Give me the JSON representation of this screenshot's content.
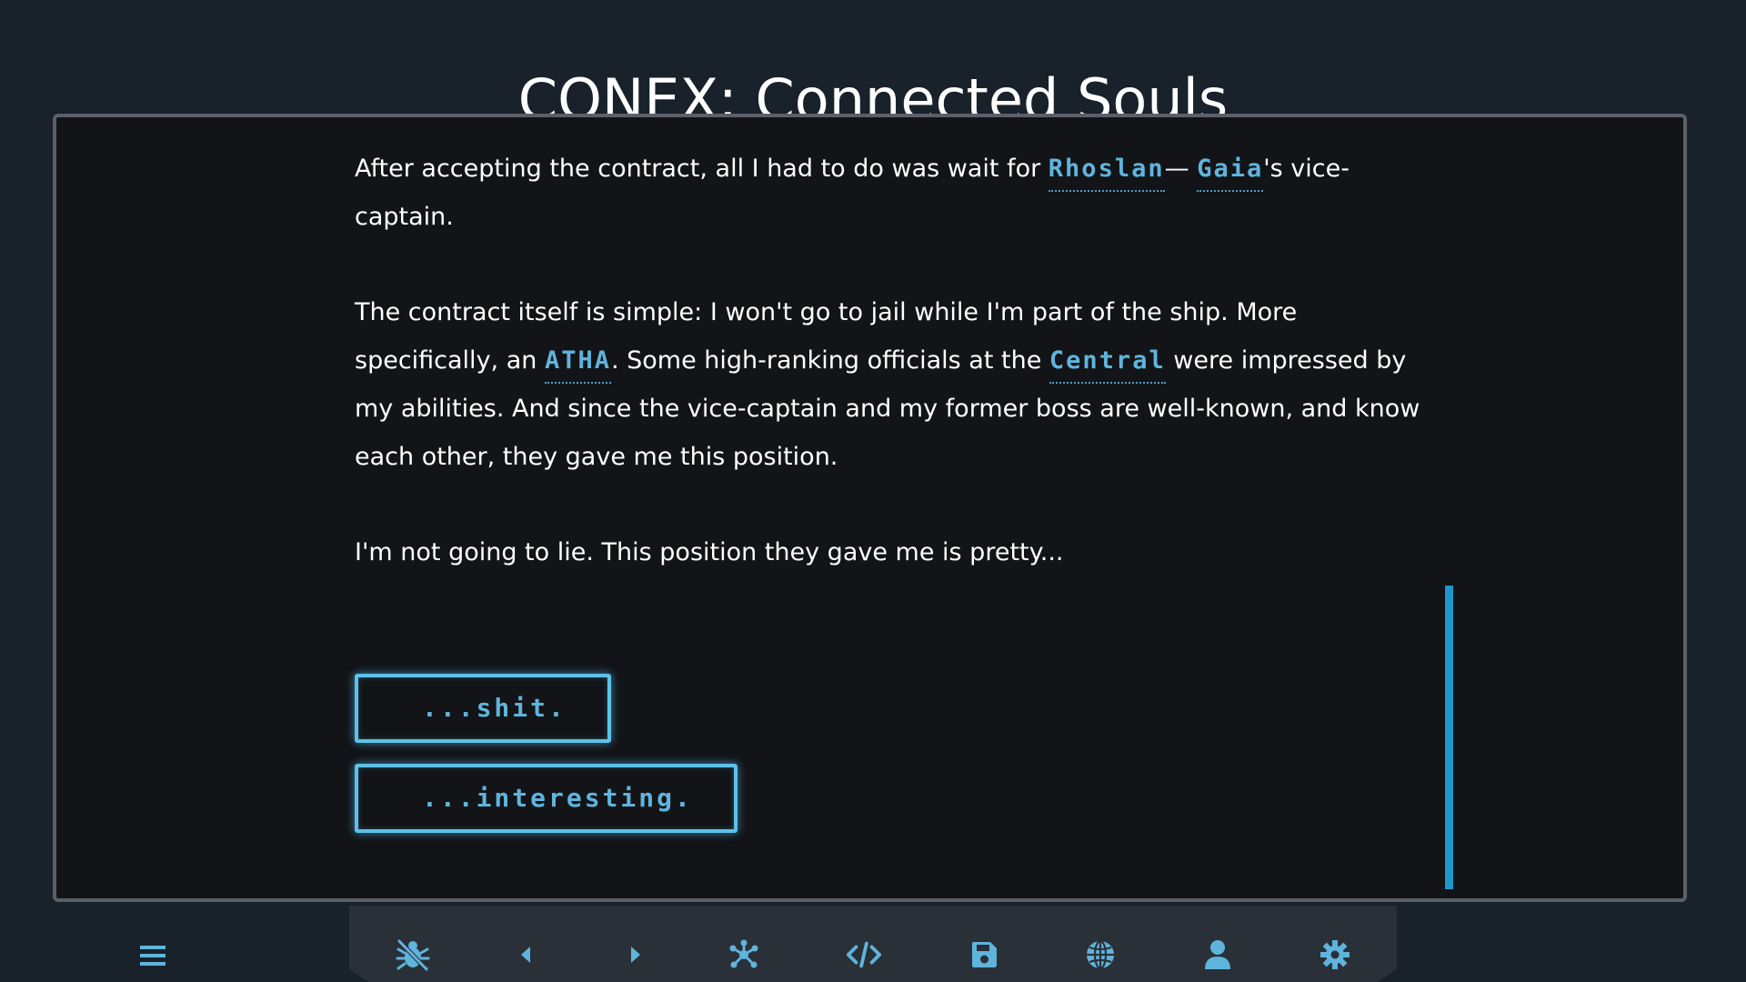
{
  "window": {
    "title": "CONEX: Connected Souls"
  },
  "passage": {
    "p1": {
      "before": "After accepting the contract, all I had to do was wait for ",
      "term1": "Rhoslan",
      "dash": "— ",
      "term2": "Gaia",
      "after": "'s vice-captain."
    },
    "p2": {
      "before": "The contract itself is simple: I won't go to jail while I'm part of the ship. More specifically, an ",
      "term1": "ATHA",
      "middle": ". Some high-ranking officials at the ",
      "term2": "Central",
      "after": " were impressed by my abilities. And since the vice-captain and my former boss are well-known, and know each other, they gave me this position."
    },
    "p3": "I'm not going to lie. This position they gave me is pretty..."
  },
  "choices": [
    {
      "label": "...shit."
    },
    {
      "label": "...interesting."
    }
  ],
  "toolbar": {
    "buttons": [
      {
        "icon": "bug-icon"
      },
      {
        "icon": "back-arrow-icon"
      },
      {
        "icon": "forward-arrow-icon"
      },
      {
        "icon": "network-icon"
      },
      {
        "icon": "code-icon"
      },
      {
        "icon": "save-icon"
      },
      {
        "icon": "globe-icon"
      },
      {
        "icon": "user-icon"
      },
      {
        "icon": "gear-icon"
      }
    ],
    "menu_icon": "hamburger-menu-icon"
  },
  "colors": {
    "background": "#19212a",
    "panel": "#121417",
    "accent": "#5fb4dc",
    "choice_border": "#5fc1ea",
    "toolbar": "#2a3038",
    "text": "#ffffff"
  }
}
